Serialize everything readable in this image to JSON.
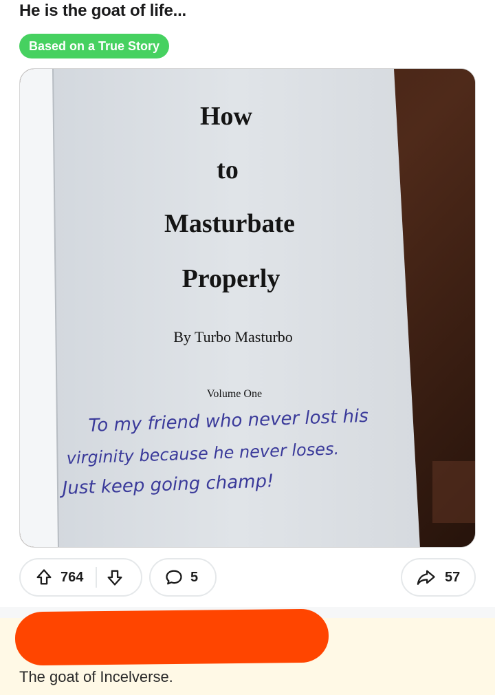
{
  "post": {
    "title": "He is the goat of life...",
    "flair": "Based on a True Story",
    "flair_color": "#46d160"
  },
  "image": {
    "book_title_lines": [
      "How",
      "to",
      "Masturbate",
      "Properly"
    ],
    "author": "By Turbo Masturbo",
    "volume": "Volume One",
    "inscription_lines": [
      "To my friend who never lost his",
      "virginity because he never loses.",
      "Just keep going champ!"
    ]
  },
  "actions": {
    "upvote_icon": "arrow-up-icon",
    "upvotes": "764",
    "downvote_icon": "arrow-down-icon",
    "comment_icon": "comment-bubble-icon",
    "comments": "5",
    "share_icon": "share-arrow-icon",
    "shares": "57"
  },
  "comment": {
    "text": "The goat of Incelverse.",
    "redaction_color": "#ff4500"
  }
}
